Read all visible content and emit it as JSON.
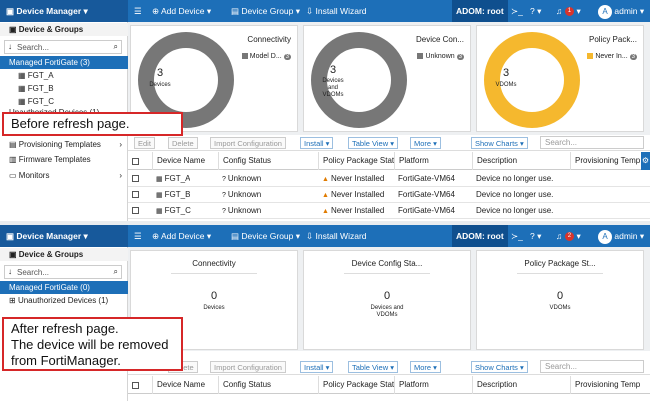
{
  "shots": {
    "before": {
      "topbar": {
        "title": "Device Manager",
        "add_device": "Add Device",
        "device_group": "Device Group",
        "install_wizard": "Install Wizard",
        "adom": "ADOM: root",
        "notif_count": "1",
        "user": "admin",
        "avatar_letter": "A"
      },
      "sidebar": {
        "device_groups": "Device & Groups",
        "search": "Search...",
        "managed": "Managed FortiGate (3)",
        "devices": [
          "FGT_A",
          "FGT_B",
          "FGT_C"
        ],
        "unauthorized": "Unauthorized Devices (1)",
        "provisioning": "Provisioning Templates",
        "firmware": "Firmware Templates",
        "monitors": "Monitors"
      },
      "cards": [
        {
          "title": "Connectivity",
          "legend": "Model D...",
          "legend_count": "3",
          "value": "3",
          "caption": "Devices"
        },
        {
          "title": "Device Con...",
          "legend": "Unknown",
          "legend_count": "3",
          "value": "3",
          "caption": "Devices and VDOMs"
        },
        {
          "title": "Policy Pack...",
          "legend": "Never In...",
          "legend_count": "3",
          "value": "3",
          "caption": "VDOMs"
        }
      ],
      "toolbar": {
        "edit": "Edit",
        "delete": "Delete",
        "import": "Import Configuration",
        "install": "Install",
        "table_view": "Table View",
        "more": "More",
        "show_charts": "Show Charts",
        "search": "Search..."
      },
      "columns": [
        "Device Name",
        "Config Status",
        "Policy Package Statu",
        "Platform",
        "Description",
        "Provisioning Templa"
      ],
      "rows": [
        {
          "name": "FGT_A",
          "config": "Unknown",
          "policy": "Never Installed",
          "platform": "FortiGate-VM64",
          "desc": "Device no longer use."
        },
        {
          "name": "FGT_B",
          "config": "Unknown",
          "policy": "Never Installed",
          "platform": "FortiGate-VM64",
          "desc": "Device no longer use."
        },
        {
          "name": "FGT_C",
          "config": "Unknown",
          "policy": "Never Installed",
          "platform": "FortiGate-VM64",
          "desc": "Device no longer use."
        }
      ],
      "callout": "Before refresh page."
    },
    "after": {
      "topbar": {
        "title": "Device Manager",
        "add_device": "Add Device",
        "device_group": "Device Group",
        "install_wizard": "Install Wizard",
        "adom": "ADOM: root",
        "notif_count": "2",
        "user": "admin",
        "avatar_letter": "A"
      },
      "sidebar": {
        "device_groups": "Device & Groups",
        "search": "Search...",
        "managed": "Managed FortiGate (0)",
        "unauthorized": "Unauthorized Devices (1)"
      },
      "cards": [
        {
          "title": "Connectivity",
          "value": "0",
          "caption": "Devices"
        },
        {
          "title": "Device Config Sta...",
          "value": "0",
          "caption": "Devices and VDOMs"
        },
        {
          "title": "Policy Package St...",
          "value": "0",
          "caption": "VDOMs"
        }
      ],
      "toolbar": {
        "delete": "Delete",
        "import": "Import Configuration",
        "install": "Install",
        "table_view": "Table View",
        "more": "More",
        "show_charts": "Show Charts",
        "search": "Search..."
      },
      "columns": [
        "Device Name",
        "Config Status",
        "Policy Package Statu",
        "Platform",
        "Description",
        "Provisioning Templa"
      ],
      "callout_lines": [
        "After refresh page.",
        "The device will be removed",
        "from FortiManager."
      ]
    }
  },
  "colors": {
    "brand": "#1d6fb8",
    "donut_grey": "#777777",
    "donut_yellow": "#f5b82e",
    "callout_border": "#d62728",
    "badge": "#d9342b"
  },
  "icons": [
    "hamburger-icon",
    "plus-icon",
    "folder-icon",
    "install-icon",
    "terminal-icon",
    "help-icon",
    "bell-icon",
    "search-icon",
    "sort-icon",
    "device-icon",
    "gear-icon",
    "warning-icon",
    "question-icon"
  ]
}
